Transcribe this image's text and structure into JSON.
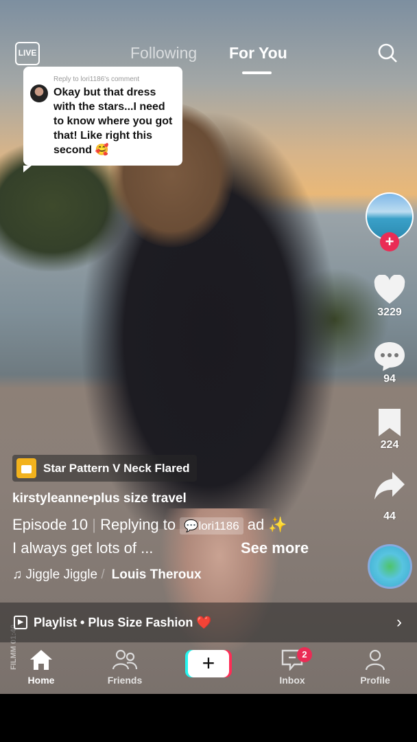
{
  "header": {
    "live_label": "LIVE",
    "tabs": [
      {
        "label": "Following",
        "active": false
      },
      {
        "label": "For You",
        "active": true
      }
    ],
    "search_icon": "search-icon"
  },
  "comment_bubble": {
    "reply_to": "Reply to lori1186's comment",
    "text": "Okay but that dress with the stars...I need to know where you got that! Like right this second 🥰"
  },
  "actions": {
    "likes": "3229",
    "comments": "94",
    "bookmarks": "224",
    "shares": "44"
  },
  "video_info": {
    "product": "Star Pattern V Neck Flared",
    "username": "kirstyleanne•plus size travel",
    "episode": "Episode 10",
    "replying_to": "Replying to",
    "mention": "lori1186",
    "desc_tail": "ad ✨",
    "caption": "I always get lots of ...",
    "see_more": "See more",
    "song": "Jiggle Jiggle",
    "artist": "Louis Theroux"
  },
  "playlist": {
    "label": "Playlist • Plus Size Fashion ❤️"
  },
  "watermark": "FILMM 01:40",
  "bottom_nav": {
    "items": [
      {
        "label": "Home",
        "active": true
      },
      {
        "label": "Friends"
      },
      {
        "label": "+"
      },
      {
        "label": "Inbox",
        "badge": "2"
      },
      {
        "label": "Profile"
      }
    ]
  },
  "colors": {
    "accent": "#ea2c55",
    "product_tag": "#f2b21d"
  }
}
